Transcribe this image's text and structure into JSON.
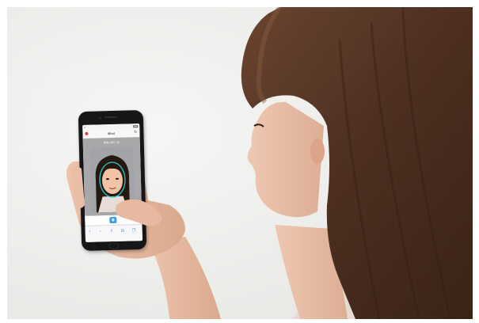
{
  "scene": {
    "kind": "photo",
    "background_color": "#efefed",
    "hair_color": "#4a2f20",
    "skin_color": "#e8bba3"
  },
  "phone_ui": {
    "url_title": "Mbot",
    "caption": "標識 | 標記 | 讀",
    "shutter_icon": "camera-icon",
    "toolbar_icons": [
      "back-arrow-icon",
      "forward-arrow-icon",
      "share-icon",
      "bookmarks-icon",
      "tabs-icon"
    ],
    "face_guide_color": "#29c6d4",
    "accent_color": "#3d9de0"
  }
}
